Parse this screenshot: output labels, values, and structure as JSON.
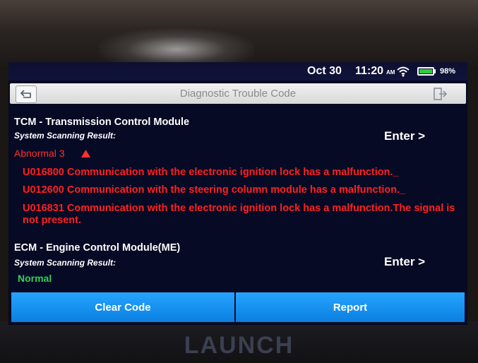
{
  "status_bar": {
    "date": "Oct 30",
    "time": "11:20",
    "ampm": "AM",
    "battery": "98%",
    "icons": [
      "wifi-icon",
      "battery-icon"
    ]
  },
  "header": {
    "title": "Diagnostic Trouble Code",
    "back_icon": "back-arrow-icon",
    "exit_icon": "exit-icon"
  },
  "systems": [
    {
      "name": "TCM - Transmission Control Module",
      "scan_label": "System Scanning Result:",
      "enter_label": "Enter >",
      "status": "Abnormal 3",
      "status_icon": "triangle-up-icon",
      "codes": [
        "U016800 Communication with the electronic ignition lock has a malfunction._",
        "U012600 Communication with the steering column module has a malfunction._",
        "U016831 Communication with the electronic ignition lock has a malfunction.The signal is not present."
      ]
    },
    {
      "name": "ECM - Engine Control Module(ME)",
      "scan_label": "System Scanning Result:",
      "enter_label": "Enter >",
      "status": "Normal"
    }
  ],
  "footer": {
    "clear_label": "Clear Code",
    "report_label": "Report"
  },
  "brand": "LAUNCH",
  "colors": {
    "screen_bg": "#070a24",
    "error": "#ff2020",
    "ok": "#2fd05a",
    "button": "#1a93f2"
  }
}
